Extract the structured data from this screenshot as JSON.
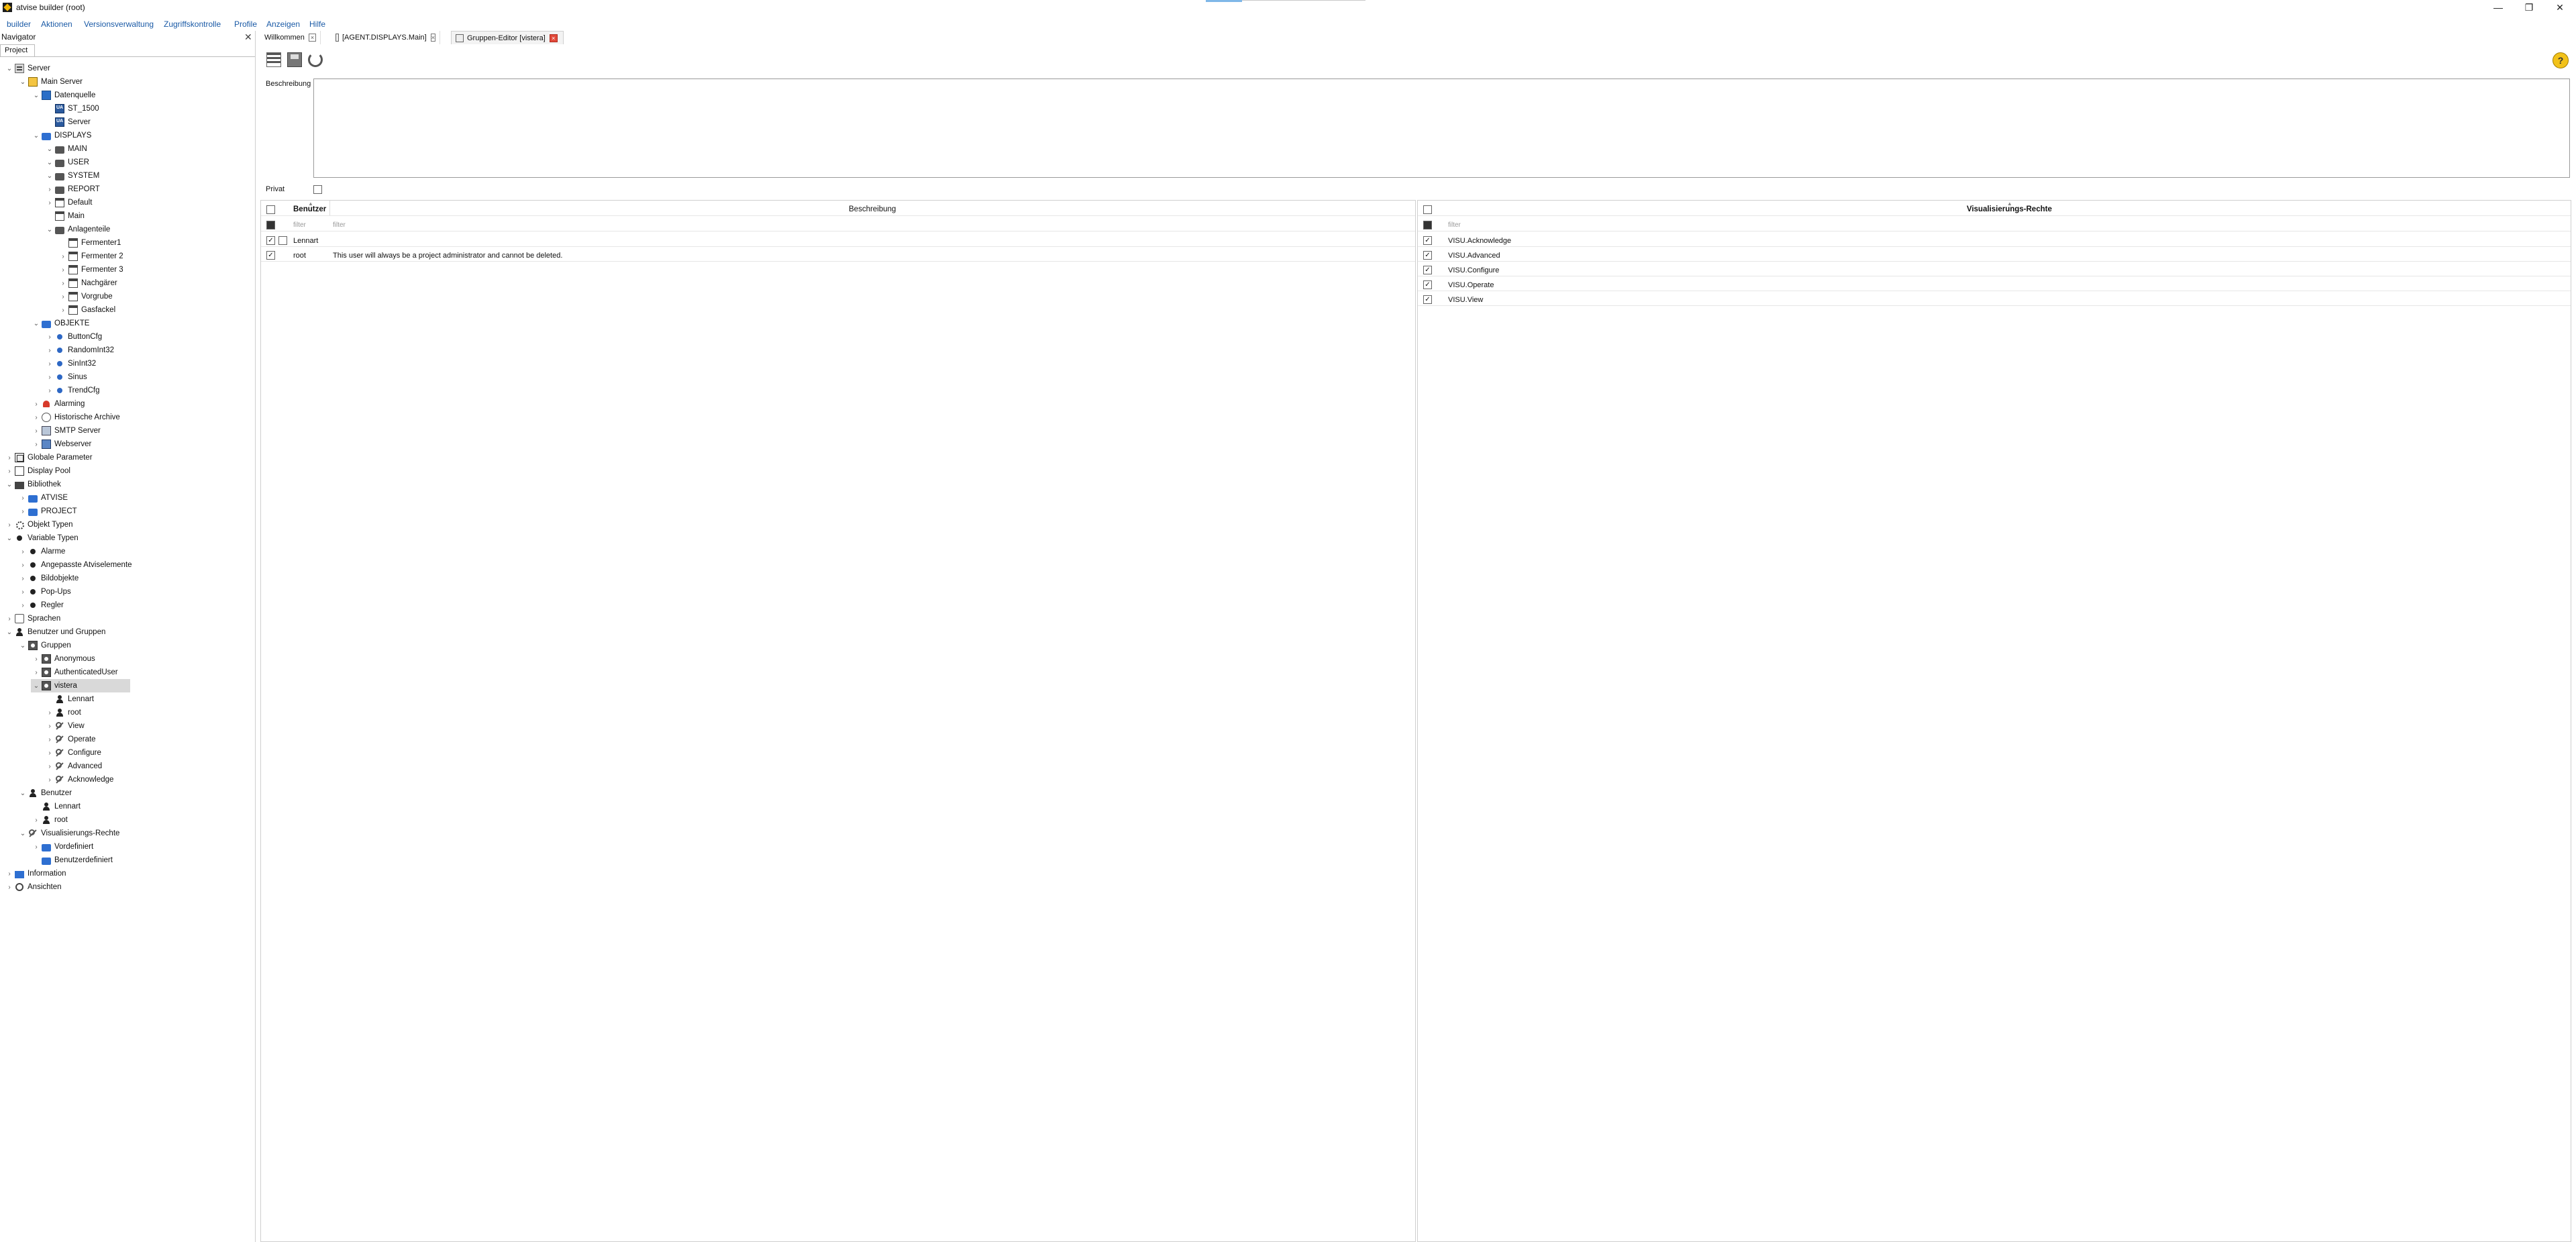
{
  "window": {
    "title": "atvise builder (root)",
    "controls": {
      "minimize": "—",
      "maximize": "❐",
      "close": "✕"
    }
  },
  "menu": [
    "builder",
    "Aktionen",
    "Versionsverwaltung",
    "Zugriffskontrolle",
    "Profile",
    "Anzeigen",
    "Hilfe"
  ],
  "navigator": {
    "title": "Navigator",
    "close": "✕",
    "tab": "Project",
    "tree": [
      {
        "label": "Server",
        "level": 0,
        "toggle": "v",
        "icon": "server"
      },
      {
        "label": "Main Server",
        "level": 1,
        "toggle": "v",
        "icon": "mainserver"
      },
      {
        "label": "Datenquelle",
        "level": 2,
        "toggle": "v",
        "icon": "blue"
      },
      {
        "label": "ST_1500",
        "level": 3,
        "toggle": "",
        "icon": "ua"
      },
      {
        "label": "Server",
        "level": 3,
        "toggle": "",
        "icon": "ua"
      },
      {
        "label": "DISPLAYS",
        "level": 2,
        "toggle": "v",
        "icon": "folder-blue"
      },
      {
        "label": "MAIN",
        "level": 3,
        "toggle": "v",
        "icon": "folder-dark"
      },
      {
        "label": "USER",
        "level": 3,
        "toggle": "v",
        "icon": "folder-dark"
      },
      {
        "label": "SYSTEM",
        "level": 3,
        "toggle": "v",
        "icon": "folder-dark"
      },
      {
        "label": "REPORT",
        "level": 3,
        "toggle": ">",
        "icon": "folder-dark"
      },
      {
        "label": "Default",
        "level": 3,
        "toggle": ">",
        "icon": "display"
      },
      {
        "label": "Main",
        "level": 3,
        "toggle": "",
        "icon": "display"
      },
      {
        "label": "Anlagenteile",
        "level": 3,
        "toggle": "v",
        "icon": "folder-dark"
      },
      {
        "label": "Fermenter1",
        "level": 4,
        "toggle": "",
        "icon": "display"
      },
      {
        "label": "Fermenter 2",
        "level": 4,
        "toggle": ">",
        "icon": "display"
      },
      {
        "label": "Fermenter 3",
        "level": 4,
        "toggle": ">",
        "icon": "display"
      },
      {
        "label": "Nachgärer",
        "level": 4,
        "toggle": ">",
        "icon": "display"
      },
      {
        "label": "Vorgrube",
        "level": 4,
        "toggle": ">",
        "icon": "display"
      },
      {
        "label": "Gasfackel",
        "level": 4,
        "toggle": ">",
        "icon": "display"
      },
      {
        "label": "OBJEKTE",
        "level": 2,
        "toggle": "v",
        "icon": "folder-blue"
      },
      {
        "label": "ButtonCfg",
        "level": 3,
        "toggle": ">",
        "icon": "dot-blue"
      },
      {
        "label": "RandomInt32",
        "level": 3,
        "toggle": ">",
        "icon": "dot-blue"
      },
      {
        "label": "SinInt32",
        "level": 3,
        "toggle": ">",
        "icon": "dot-blue"
      },
      {
        "label": "Sinus",
        "level": 3,
        "toggle": ">",
        "icon": "dot-blue"
      },
      {
        "label": "TrendCfg",
        "level": 3,
        "toggle": ">",
        "icon": "dot-blue"
      },
      {
        "label": "Alarming",
        "level": 2,
        "toggle": ">",
        "icon": "alarm"
      },
      {
        "label": "Historische Archive",
        "level": 2,
        "toggle": ">",
        "icon": "archive"
      },
      {
        "label": "SMTP Server",
        "level": 2,
        "toggle": ">",
        "icon": "smtp"
      },
      {
        "label": "Webserver",
        "level": 2,
        "toggle": ">",
        "icon": "web"
      },
      {
        "label": "Globale Parameter",
        "level": 0,
        "toggle": ">",
        "icon": "global"
      },
      {
        "label": "Display Pool",
        "level": 0,
        "toggle": ">",
        "icon": "display-pool"
      },
      {
        "label": "Bibliothek",
        "level": 0,
        "toggle": "v",
        "icon": "library"
      },
      {
        "label": "ATVISE",
        "level": 1,
        "toggle": ">",
        "icon": "folder-blue"
      },
      {
        "label": "PROJECT",
        "level": 1,
        "toggle": ">",
        "icon": "folder-blue"
      },
      {
        "label": "Objekt Typen",
        "level": 0,
        "toggle": ">",
        "icon": "gear"
      },
      {
        "label": "Variable Typen",
        "level": 0,
        "toggle": "v",
        "icon": "dot-black"
      },
      {
        "label": "Alarme",
        "level": 1,
        "toggle": ">",
        "icon": "dot-black"
      },
      {
        "label": "Angepasste Atviselemente",
        "level": 1,
        "toggle": ">",
        "icon": "dot-black"
      },
      {
        "label": "Bildobjekte",
        "level": 1,
        "toggle": ">",
        "icon": "dot-black"
      },
      {
        "label": "Pop-Ups",
        "level": 1,
        "toggle": ">",
        "icon": "dot-black"
      },
      {
        "label": "Regler",
        "level": 1,
        "toggle": ">",
        "icon": "dot-black"
      },
      {
        "label": "Sprachen",
        "level": 0,
        "toggle": ">",
        "icon": "lang"
      },
      {
        "label": "Benutzer und Gruppen",
        "level": 0,
        "toggle": "v",
        "icon": "person"
      },
      {
        "label": "Gruppen",
        "level": 1,
        "toggle": "v",
        "icon": "group"
      },
      {
        "label": "Anonymous",
        "level": 2,
        "toggle": ">",
        "icon": "group"
      },
      {
        "label": "AuthenticatedUser",
        "level": 2,
        "toggle": ">",
        "icon": "group"
      },
      {
        "label": "vistera",
        "level": 2,
        "toggle": "v",
        "icon": "group",
        "selected": true
      },
      {
        "label": "Lennart",
        "level": 3,
        "toggle": "",
        "icon": "person"
      },
      {
        "label": "root",
        "level": 3,
        "toggle": ">",
        "icon": "person"
      },
      {
        "label": "View",
        "level": 3,
        "toggle": ">",
        "icon": "wrench"
      },
      {
        "label": "Operate",
        "level": 3,
        "toggle": ">",
        "icon": "wrench"
      },
      {
        "label": "Configure",
        "level": 3,
        "toggle": ">",
        "icon": "wrench"
      },
      {
        "label": "Advanced",
        "level": 3,
        "toggle": ">",
        "icon": "wrench"
      },
      {
        "label": "Acknowledge",
        "level": 3,
        "toggle": ">",
        "icon": "wrench"
      },
      {
        "label": "Benutzer",
        "level": 1,
        "toggle": "v",
        "icon": "person"
      },
      {
        "label": "Lennart",
        "level": 2,
        "toggle": "",
        "icon": "person"
      },
      {
        "label": "root",
        "level": 2,
        "toggle": ">",
        "icon": "person"
      },
      {
        "label": "Visualisierungs-Rechte",
        "level": 1,
        "toggle": "v",
        "icon": "wrench"
      },
      {
        "label": "Vordefiniert",
        "level": 2,
        "toggle": ">",
        "icon": "folder-blue"
      },
      {
        "label": "Benutzerdefiniert",
        "level": 2,
        "toggle": "",
        "icon": "folder-blue"
      },
      {
        "label": "Information",
        "level": 0,
        "toggle": ">",
        "icon": "info"
      },
      {
        "label": "Ansichten",
        "level": 0,
        "toggle": ">",
        "icon": "search"
      }
    ]
  },
  "tabs": [
    {
      "label": "Willkommen",
      "active": false
    },
    {
      "label": "[AGENT.DISPLAYS.Main]",
      "active": false
    },
    {
      "label": "Gruppen-Editor [vistera]",
      "active": true
    }
  ],
  "editor": {
    "description_label": "Beschreibung",
    "description_value": "",
    "private_label": "Privat",
    "private_checked": false,
    "help": "?"
  },
  "users_table": {
    "headers": {
      "user": "Benutzer",
      "description": "Beschreibung"
    },
    "filter_placeholder": "filter",
    "rows": [
      {
        "checked": true,
        "user": "Lennart",
        "description": ""
      },
      {
        "checked": true,
        "user": "root",
        "description": "This user will always be a project administrator and cannot be deleted."
      }
    ]
  },
  "rights_table": {
    "header": "Visualisierungs-Rechte",
    "filter_placeholder": "filter",
    "rows": [
      {
        "checked": true,
        "right": "VISU.Acknowledge"
      },
      {
        "checked": true,
        "right": "VISU.Advanced"
      },
      {
        "checked": true,
        "right": "VISU.Configure"
      },
      {
        "checked": true,
        "right": "VISU.Operate"
      },
      {
        "checked": true,
        "right": "VISU.View"
      }
    ]
  }
}
